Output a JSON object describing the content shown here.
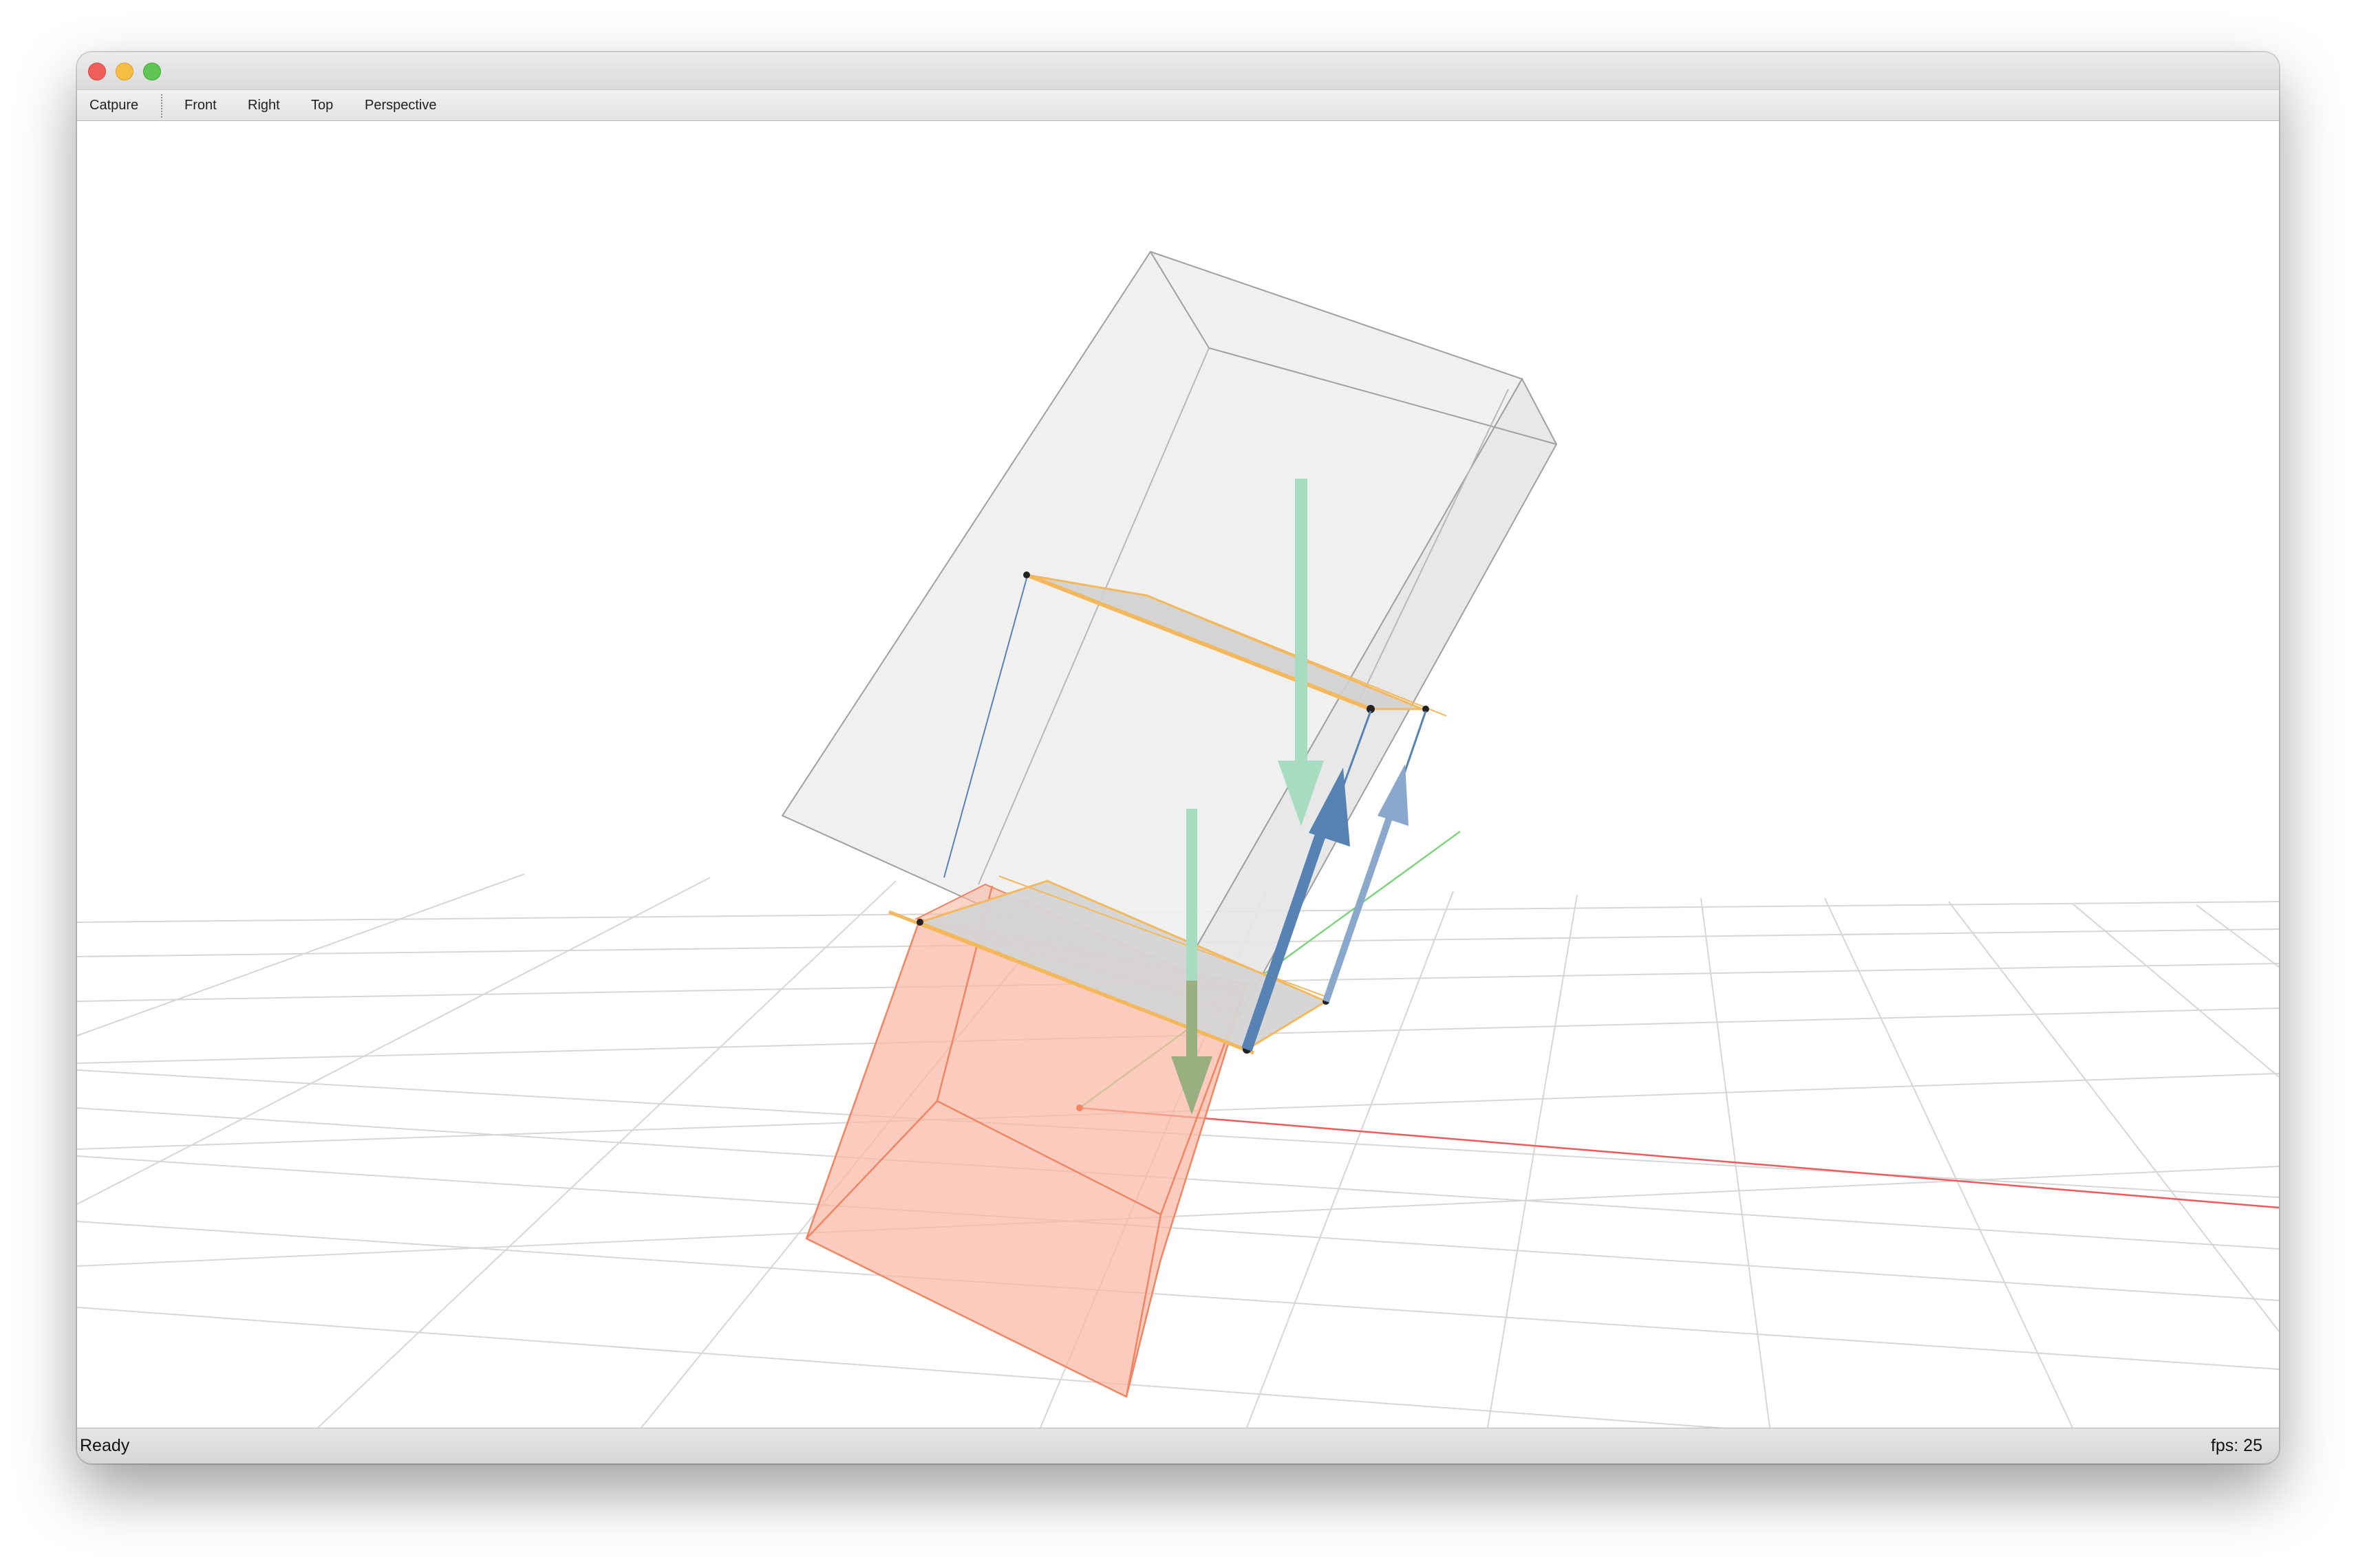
{
  "toolbar": {
    "capture": "Catpure",
    "front": "Front",
    "right": "Right",
    "top": "Top",
    "perspective": "Perspective"
  },
  "status": {
    "message": "Ready",
    "fps": "fps: 25"
  },
  "colors": {
    "grid": "#d6d6d6",
    "body": "#ececec",
    "box_edge": "#a0a0a0",
    "lower_block": "#f9b8a4",
    "lower_block_edge": "#f08563",
    "slice_plane": "#f4b85c",
    "force_green": "#a8dcc0",
    "force_blue": "#5782b4",
    "axis_x": "#ef5b5b",
    "axis_y": "#7ed37e"
  }
}
